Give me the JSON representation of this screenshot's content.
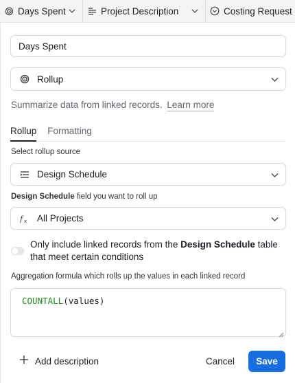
{
  "header": {
    "columns": [
      {
        "label": "Days Spent",
        "icon": "rollup-icon"
      },
      {
        "label": "Project Description",
        "icon": "long-text-icon"
      },
      {
        "label": "Costing Request",
        "icon": "single-select-icon"
      }
    ]
  },
  "editor": {
    "field_name": "Days Spent",
    "field_type": "Rollup",
    "description": "Summarize data from linked records.",
    "learn_more": "Learn more",
    "tabs": [
      "Rollup",
      "Formatting"
    ],
    "active_tab": "Rollup",
    "source_label": "Select rollup source",
    "source_value": "Design Schedule",
    "field_label_bold": "Design Schedule",
    "field_label_rest": " field you want to roll up",
    "field_value": "All Projects",
    "toggle": {
      "text_before": "Only include linked records from the ",
      "text_bold": "Design Schedule",
      "text_after": " table that meet certain conditions",
      "on": false
    },
    "formula_label": "Aggregation formula which rolls up the values in each linked record",
    "formula_fn": "COUNTALL",
    "formula_args": "(values)",
    "add_description": "Add description",
    "cancel_label": "Cancel",
    "save_label": "Save"
  },
  "colors": {
    "accent": "#166ee1",
    "formula_fn": "#1c8a1c"
  }
}
